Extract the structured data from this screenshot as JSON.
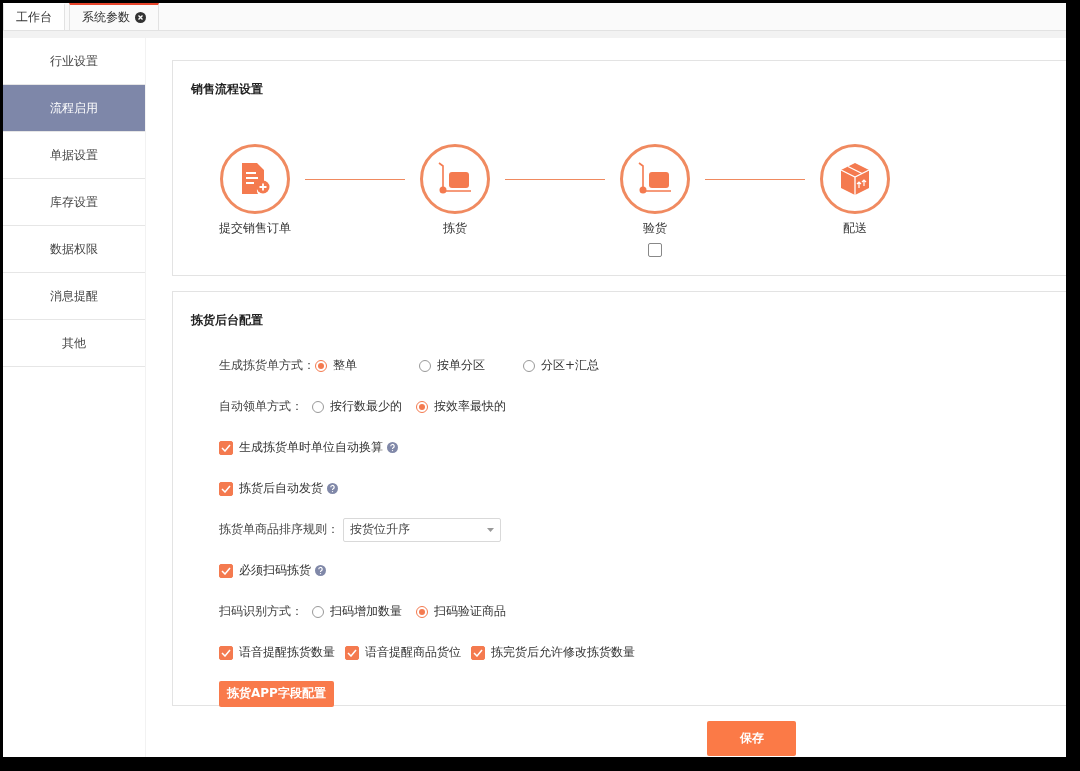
{
  "tabs": [
    {
      "label": "工作台",
      "selected": false,
      "closable": false
    },
    {
      "label": "系统参数",
      "selected": true,
      "closable": true
    }
  ],
  "sidebar": {
    "items": [
      {
        "label": "行业设置",
        "selected": false
      },
      {
        "label": "流程启用",
        "selected": true
      },
      {
        "label": "单据设置",
        "selected": false
      },
      {
        "label": "库存设置",
        "selected": false
      },
      {
        "label": "数据权限",
        "selected": false
      },
      {
        "label": "消息提醒",
        "selected": false
      },
      {
        "label": "其他",
        "selected": false
      }
    ]
  },
  "flow_panel": {
    "title": "销售流程设置",
    "steps": [
      {
        "label": "提交销售订单",
        "kind": "document"
      },
      {
        "label": "拣货",
        "kind": "trolley"
      },
      {
        "label": "验货",
        "kind": "trolley",
        "checked": false
      },
      {
        "label": "配送",
        "kind": "box"
      }
    ]
  },
  "config_panel": {
    "title": "拣货后台配置",
    "rows": [
      {
        "kind": "radio",
        "label": "生成拣货单方式：",
        "options": [
          {
            "label": "整单",
            "selected": true
          },
          {
            "label": "按单分区",
            "selected": false
          },
          {
            "label": "分区+汇总",
            "selected": false
          }
        ]
      },
      {
        "kind": "radio",
        "label": "自动领单方式：",
        "options": [
          {
            "label": "按行数最少的",
            "selected": false
          },
          {
            "label": "按效率最快的",
            "selected": true
          }
        ]
      },
      {
        "kind": "checkbox",
        "items": [
          {
            "label": "生成拣货单时单位自动换算",
            "checked": true,
            "help": true
          }
        ]
      },
      {
        "kind": "checkbox",
        "items": [
          {
            "label": "拣货后自动发货",
            "checked": true,
            "help": true
          }
        ]
      },
      {
        "kind": "select",
        "label": "拣货单商品排序规则：",
        "value": "按货位升序"
      },
      {
        "kind": "checkbox",
        "items": [
          {
            "label": "必须扫码拣货",
            "checked": true,
            "help": true
          }
        ]
      },
      {
        "kind": "radio",
        "label": "扫码识别方式：",
        "options": [
          {
            "label": "扫码增加数量",
            "selected": false
          },
          {
            "label": "扫码验证商品",
            "selected": true
          }
        ]
      },
      {
        "kind": "checkbox",
        "items": [
          {
            "label": "语音提醒拣货数量",
            "checked": true,
            "help": false
          },
          {
            "label": "语音提醒商品货位",
            "checked": true,
            "help": false
          },
          {
            "label": "拣完货后允许修改拣货数量",
            "checked": true,
            "help": false
          }
        ]
      },
      {
        "kind": "button",
        "label": "拣货APP字段配置"
      }
    ]
  },
  "save_button": "保存"
}
